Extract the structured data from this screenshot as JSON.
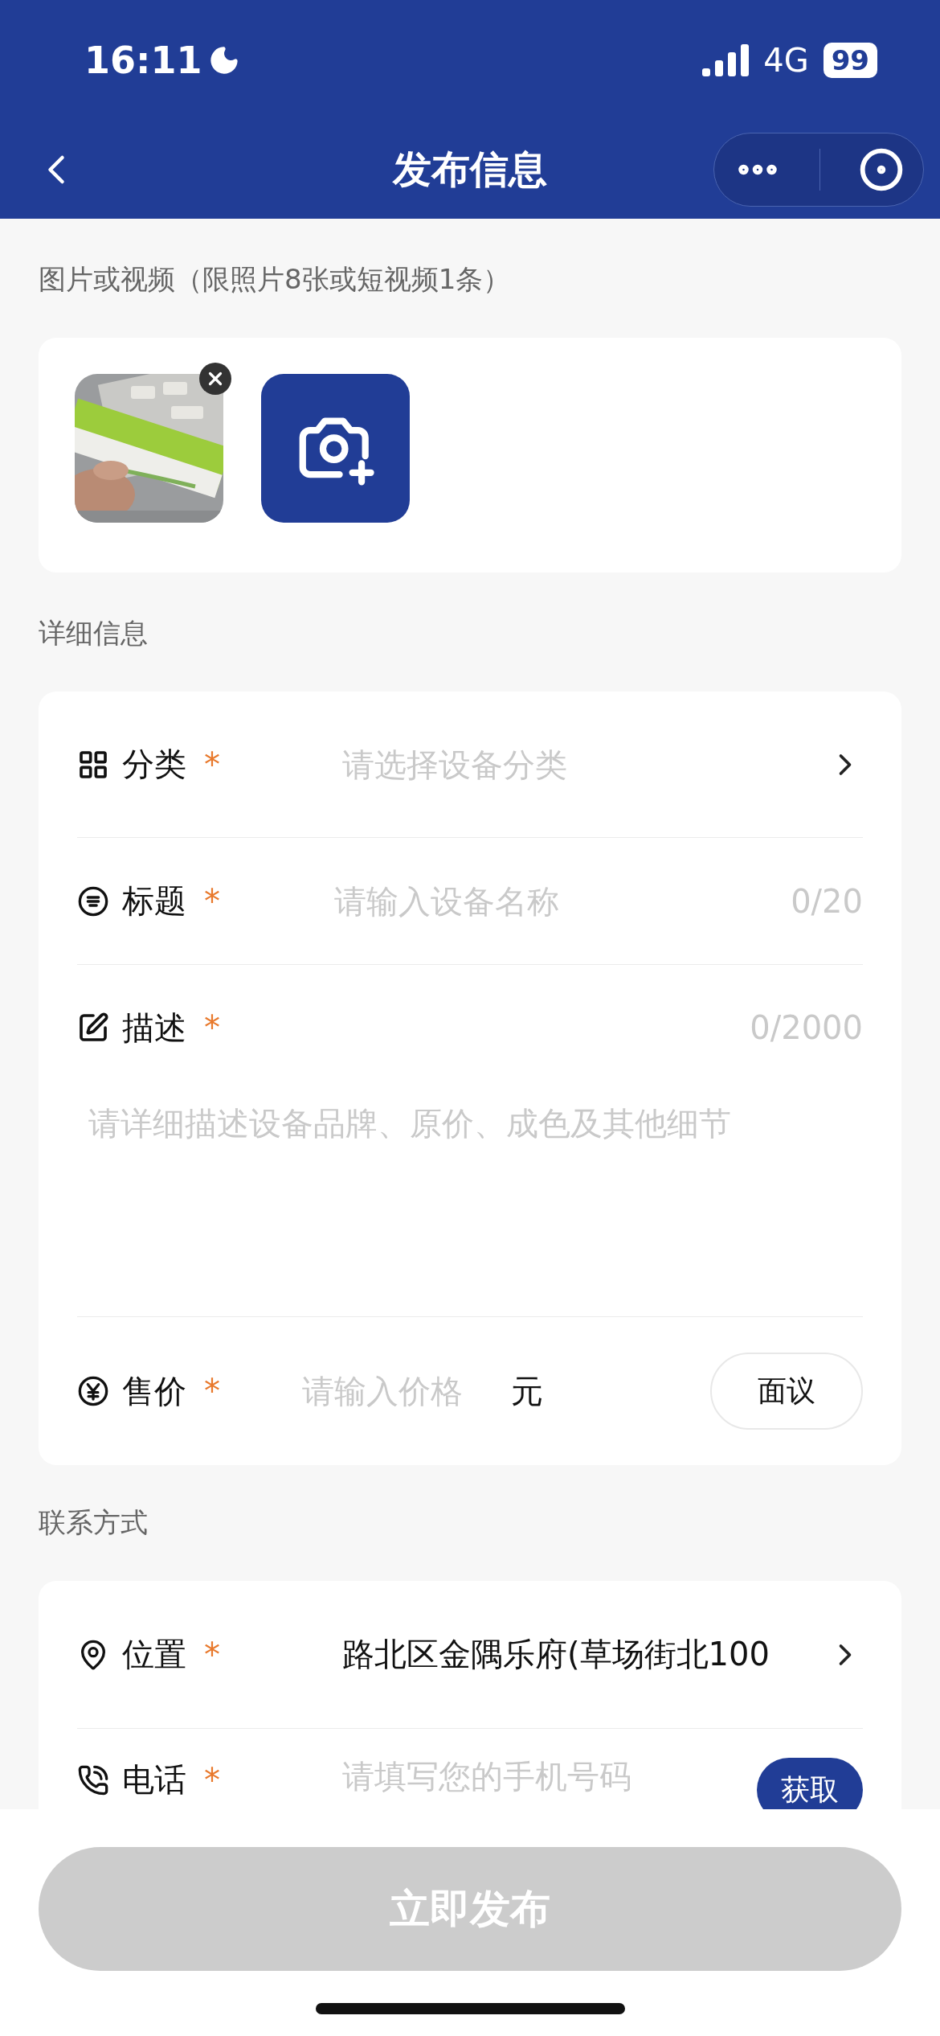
{
  "status_bar": {
    "time": "16:11",
    "network": "4G",
    "battery": "99"
  },
  "nav": {
    "title": "发布信息"
  },
  "media": {
    "label": "图片或视频（限照片8张或短视频1条）",
    "items": [
      {
        "kind": "picture"
      },
      {
        "kind": "add"
      }
    ]
  },
  "details": {
    "label": "详细信息",
    "fields": [
      {
        "kind": "select",
        "label": "分类",
        "required_mark": "*",
        "placeholder": "请选择设备分类"
      },
      {
        "kind": "text",
        "label": "标题",
        "required_mark": "*",
        "placeholder": "请输入设备名称",
        "counter": "0/20"
      },
      {
        "kind": "textarea",
        "label": "描述",
        "required_mark": "*",
        "placeholder": "请详细描述设备品牌、原价、成色及其他细节",
        "counter": "0/2000"
      },
      {
        "kind": "price",
        "label": "售价",
        "required_mark": "*",
        "placeholder": "请输入价格",
        "unit": "元",
        "button": "面议"
      }
    ]
  },
  "contact": {
    "label": "联系方式",
    "fields": [
      {
        "kind": "select",
        "label": "位置",
        "required_mark": "*",
        "value": "路北区金隅乐府(草场街北100"
      },
      {
        "kind": "phone",
        "label": "电话",
        "required_mark": "*",
        "placeholder": "请填写您的手机号码",
        "button": "获取"
      }
    ]
  },
  "submit": {
    "label": "立即发布",
    "disabled": true
  }
}
